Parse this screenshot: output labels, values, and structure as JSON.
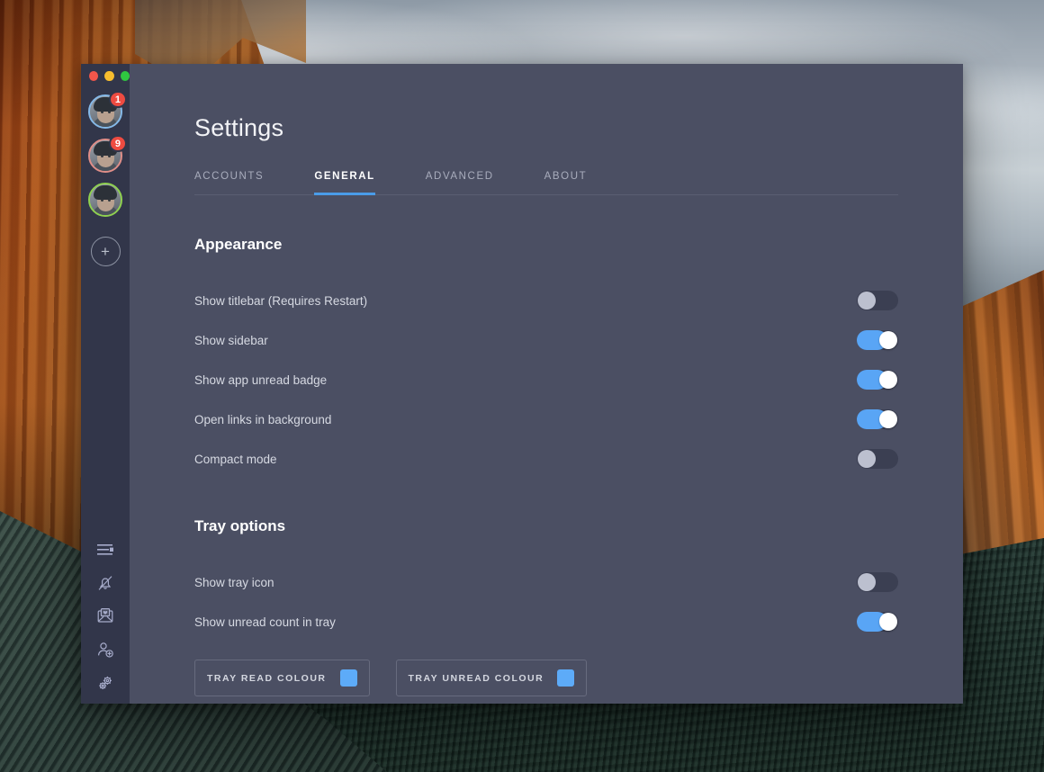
{
  "window": {
    "traffic_lights": [
      {
        "name": "close",
        "color": "#f2564b"
      },
      {
        "name": "minimize",
        "color": "#f7bd2e"
      },
      {
        "name": "maximize",
        "color": "#2fc840"
      }
    ]
  },
  "sidebar": {
    "accounts": [
      {
        "name": "account-1",
        "ring_color": "#85b9e8",
        "badge": "1"
      },
      {
        "name": "account-2",
        "ring_color": "#e08e88",
        "badge": "9"
      },
      {
        "name": "account-3",
        "ring_color": "#8fd14f",
        "badge": ""
      }
    ],
    "add_account_label": "+",
    "tools": [
      {
        "icon": "list-lines-icon"
      },
      {
        "icon": "bell-slash-icon"
      },
      {
        "icon": "envelope-heart-icon"
      },
      {
        "icon": "add-person-icon"
      },
      {
        "icon": "gears-icon"
      }
    ]
  },
  "main": {
    "title": "Settings",
    "tabs": [
      {
        "label": "ACCOUNTS",
        "active": false
      },
      {
        "label": "GENERAL",
        "active": true
      },
      {
        "label": "ADVANCED",
        "active": false
      },
      {
        "label": "ABOUT",
        "active": false
      }
    ],
    "sections": [
      {
        "heading": "Appearance",
        "rows": [
          {
            "label": "Show titlebar (Requires Restart)",
            "state": "off"
          },
          {
            "label": "Show sidebar",
            "state": "on"
          },
          {
            "label": "Show app unread badge",
            "state": "on"
          },
          {
            "label": "Open links in background",
            "state": "on"
          },
          {
            "label": "Compact mode",
            "state": "off"
          }
        ]
      },
      {
        "heading": "Tray options",
        "rows": [
          {
            "label": "Show tray icon",
            "state": "off"
          },
          {
            "label": "Show unread count in tray",
            "state": "on"
          }
        ]
      }
    ],
    "colour_buttons": [
      {
        "label": "TRAY READ COLOUR",
        "swatch": "#5dabf8"
      },
      {
        "label": "TRAY UNREAD COLOUR",
        "swatch": "#5dabf8"
      }
    ]
  },
  "colors": {
    "accent": "#4a9ce8",
    "toggle_on": "#59a5f5",
    "toggle_off_knob": "#bcc0cf",
    "badge": "#ee4b41",
    "panel_bg": "#4b4f63",
    "sidebar_bg": "#32364a"
  }
}
